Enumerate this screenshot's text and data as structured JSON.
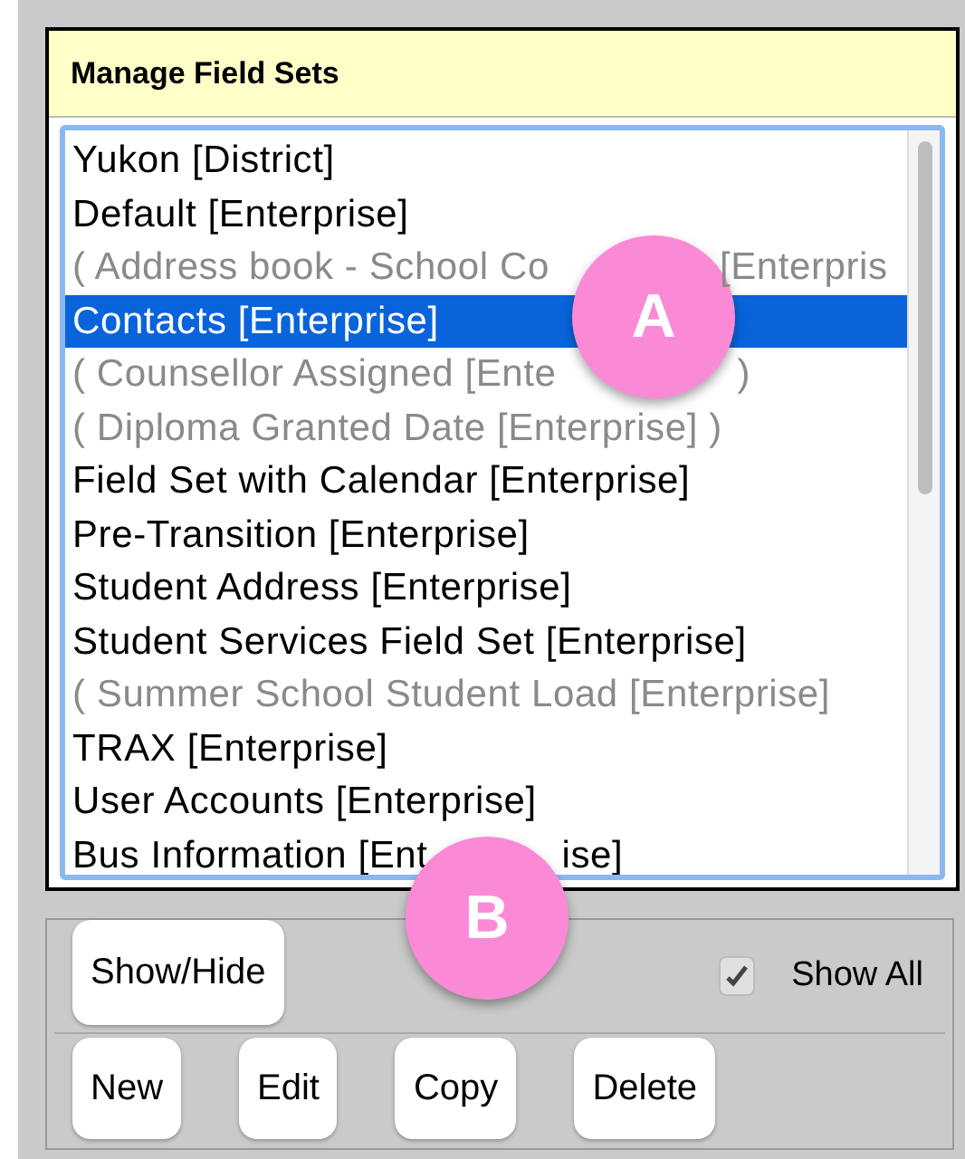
{
  "panel": {
    "title": "Manage Field Sets"
  },
  "field_sets": [
    {
      "parts": [
        "Yukon [District]"
      ],
      "hidden": false,
      "selected": false
    },
    {
      "parts": [
        "Default [Enterprise]"
      ],
      "hidden": false,
      "selected": false
    },
    {
      "parts": [
        "( Address book - School Co",
        "[Enterpris"
      ],
      "hidden": true,
      "selected": false
    },
    {
      "parts": [
        "Contacts [Enterprise]"
      ],
      "hidden": false,
      "selected": true
    },
    {
      "parts": [
        "( Counsellor Assigned [Ente",
        ")"
      ],
      "hidden": true,
      "selected": false
    },
    {
      "parts": [
        "( Diploma Granted Date [Enterprise] )"
      ],
      "hidden": true,
      "selected": false
    },
    {
      "parts": [
        "Field Set with Calendar [Enterprise]"
      ],
      "hidden": false,
      "selected": false
    },
    {
      "parts": [
        "Pre-Transition [Enterprise]"
      ],
      "hidden": false,
      "selected": false
    },
    {
      "parts": [
        "Student Address [Enterprise]"
      ],
      "hidden": false,
      "selected": false
    },
    {
      "parts": [
        "Student Services Field Set [Enterprise]"
      ],
      "hidden": false,
      "selected": false
    },
    {
      "parts": [
        "( Summer School Student Load [Enterprise]"
      ],
      "hidden": true,
      "selected": false
    },
    {
      "parts": [
        "TRAX [Enterprise]"
      ],
      "hidden": false,
      "selected": false
    },
    {
      "parts": [
        "User Accounts [Enterprise]"
      ],
      "hidden": false,
      "selected": false
    },
    {
      "parts": [
        "Bus Information [Ent",
        "ise]"
      ],
      "hidden": false,
      "selected": false
    }
  ],
  "show_hide_button": "Show/Hide",
  "show_all": {
    "label": "Show All",
    "checked": true
  },
  "action_buttons": [
    "New",
    "Edit",
    "Copy",
    "Delete"
  ],
  "callouts": [
    "A",
    "B"
  ]
}
